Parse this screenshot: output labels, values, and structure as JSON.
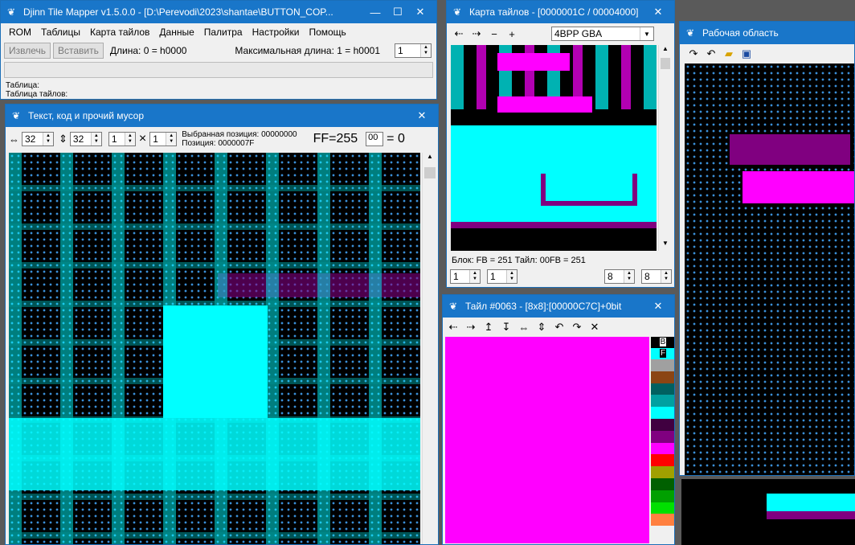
{
  "main_window": {
    "title": "Djinn Tile Mapper v1.5.0.0 - [D:\\Perevodi\\2023\\shantae\\BUTTON_COP...",
    "menu": [
      "ROM",
      "Таблицы",
      "Карта тайлов",
      "Данные",
      "Палитра",
      "Настройки",
      "Помощь"
    ],
    "extract_label": "Извлечь",
    "insert_label": "Вставить",
    "length_text": "Длина: 0 = h0000",
    "max_length_text": "Максимальная длина: 1 = h0001",
    "max_value": "1",
    "table_label": "Таблица:",
    "tile_table_label": "Таблица тайлов:"
  },
  "text_window": {
    "title": "Текст, код и прочий мусор",
    "width_value": "32",
    "height_value": "32",
    "x_value": "1",
    "y_value": "1",
    "times_sign": "×",
    "selected_pos": "Выбранная позиция: 00000000",
    "position": "Позиция: 0000007F",
    "ff_label": "FF=255",
    "code_value": "00",
    "equals_zero": "= 0"
  },
  "tilemap_window": {
    "title": "Карта тайлов - [0000001C / 00004000]",
    "format": "4BPP GBA",
    "status": "Блок: FB = 251  Тайл: 00FB = 251",
    "spin1": "1",
    "spin2": "1",
    "spin3": "8",
    "spin4": "8"
  },
  "tile_window": {
    "title": "Тайл #0063 - [8x8]:[00000C7C]+0bit",
    "bg_label": "B",
    "fg_label": "F",
    "palette": [
      "#ffffff",
      "#00ffff",
      "#a0a0a0",
      "#8b4513",
      "#006060",
      "#00a0a0",
      "#00ffff",
      "#400040",
      "#800080",
      "#ff00ff",
      "#ff0000",
      "#a0a000",
      "#006000",
      "#00a000",
      "#00e000",
      "#ff8040"
    ]
  },
  "work_window": {
    "title": "Рабочая область"
  },
  "colors": {
    "titlebar": "#1976c9",
    "cyan": "#00ffff",
    "magenta": "#ff00ff",
    "purple": "#800080"
  }
}
